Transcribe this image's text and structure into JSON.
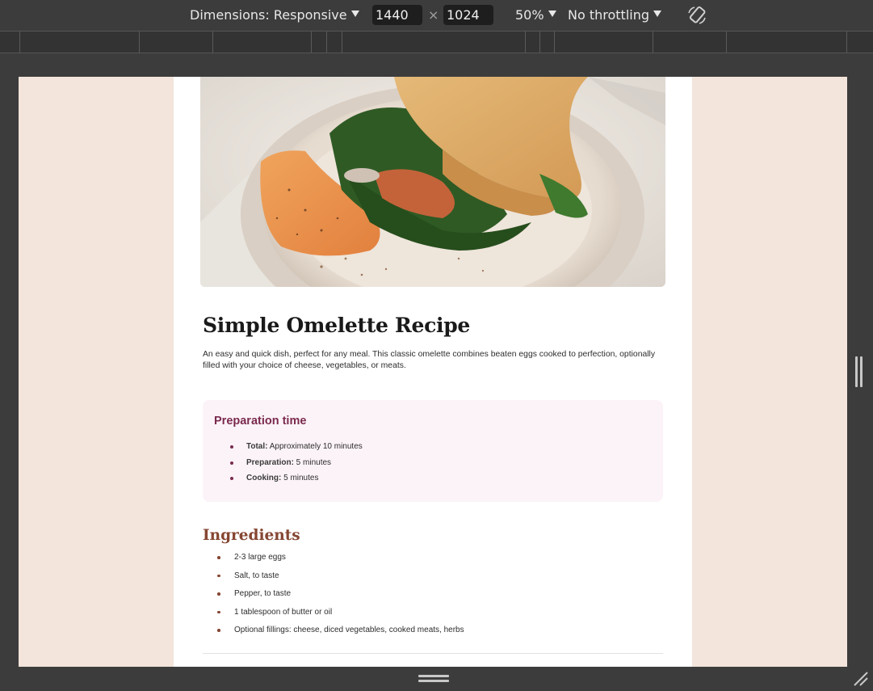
{
  "devtools": {
    "dimensions_label": "Dimensions: Responsive",
    "width_value": "1440",
    "height_value": "1024",
    "times_symbol": "×",
    "zoom_label": "50%",
    "throttling_label": "No throttling",
    "icons": [
      "caret-down-icon",
      "rotate-icon",
      "resize-handle-icon",
      "corner-grip-icon"
    ]
  },
  "recipe": {
    "hero_image_subject": "omelette-on-plate",
    "title": "Simple Omelette Recipe",
    "description": "An easy and quick dish, perfect for any meal. This classic omelette combines beaten eggs cooked to perfection, optionally filled with your choice of cheese, vegetables, or meats.",
    "prep": {
      "title": "Preparation time",
      "items": [
        {
          "label": "Total:",
          "value": " Approximately 10 minutes"
        },
        {
          "label": "Preparation:",
          "value": " 5 minutes"
        },
        {
          "label": "Cooking:",
          "value": " 5 minutes"
        }
      ]
    },
    "ingredients": {
      "title": "Ingredients",
      "items": [
        "2-3 large eggs",
        "Salt, to taste",
        "Pepper, to taste",
        "1 tablespoon of butter or oil",
        "Optional fillings: cheese, diced vegetables, cooked meats, herbs"
      ]
    }
  },
  "colors": {
    "page_background": "#f3e5db",
    "card_background": "#ffffff",
    "prep_background": "#fcf3f8",
    "prep_accent": "#7a2a4e",
    "ingredients_accent": "#854632",
    "devtools_background": "#3c3c3c"
  }
}
